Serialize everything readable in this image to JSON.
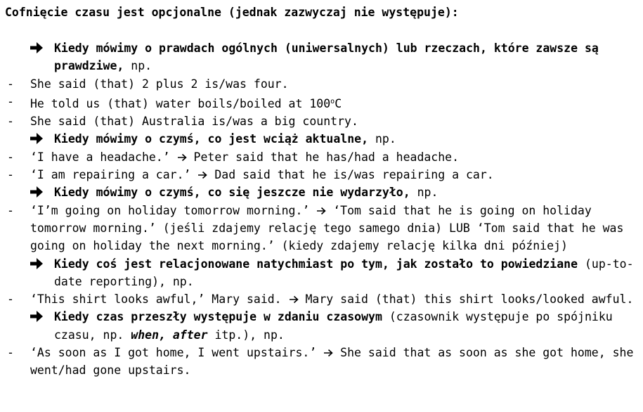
{
  "heading": "Cofnięcie czasu jest opcjonalne (jednak zazwyczaj nie występuje):",
  "rules": [
    {
      "head_bold": "Kiedy mówimy o prawdach ogólnych (uniwersalnych) lub rzeczach, które zawsze są prawdziwe,",
      "head_tail": " np.",
      "examples": [
        {
          "a": "She said (that) 2 plus 2 is/was four."
        },
        {
          "a": "He told us (that) water boils/boiled at 100",
          "deg": "o",
          "c": "C"
        },
        {
          "a": "She said (that) Australia is/was a big country."
        }
      ]
    },
    {
      "head_bold": "Kiedy mówimy o czymś, co jest wciąż aktualne,",
      "head_tail": " np.",
      "examples": [
        {
          "a": "‘I have a headache.’",
          "b": " Peter said that he has/had a headache."
        },
        {
          "a": "‘I am repairing a car.’",
          "b": " Dad said that he is/was repairing a car."
        }
      ]
    },
    {
      "head_bold": "Kiedy mówimy o czymś, co się jeszcze nie wydarzyło,",
      "head_tail": " np.",
      "examples": [
        {
          "a": "‘I’m going on holiday tomorrow morning.’",
          "b": " ‘Tom said that he is going on holiday tomorrow morning.’ (jeśli zdajemy relację tego samego dnia) LUB ‘Tom said that he was going on holiday the next morning.’ (kiedy zdajemy relację kilka dni później)"
        }
      ]
    },
    {
      "head_bold": "Kiedy coś jest relacjonowane natychmiast po tym, jak zostało to powiedziane",
      "head_tail": " (up-to-date reporting), np.",
      "examples": [
        {
          "a": "‘This shirt looks awful,’ Mary said.",
          "b": " Mary said (that) this shirt looks/looked awful."
        }
      ]
    },
    {
      "head_bold": "Kiedy czas przeszły występuje w zdaniu czasowym",
      "head_mid": " (czasownik występuje po spójniku czasu, np. ",
      "head_italic": "when, after",
      "head_tail": " itp.), np.",
      "examples": [
        {
          "a": "‘As soon as I got home, I went upstairs.’",
          "b": " She said that as soon as she got home, she went/had gone upstairs."
        }
      ]
    }
  ]
}
